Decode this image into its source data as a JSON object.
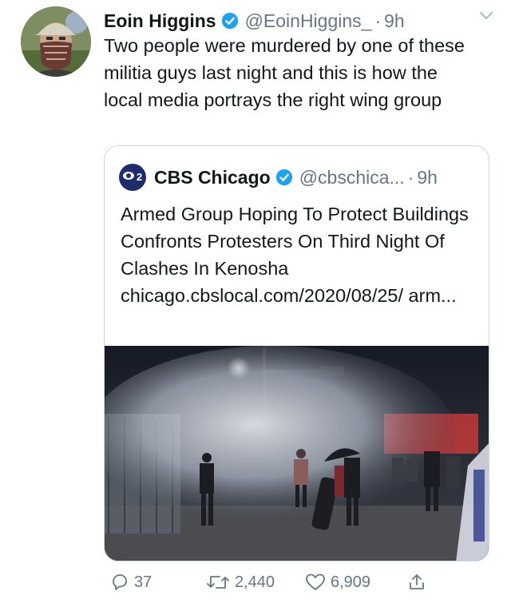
{
  "tweet": {
    "author": {
      "name": "Eoin Higgins",
      "handle": "@EoinHiggins_",
      "separator": "·",
      "time": "9h"
    },
    "text": "Two people were murdered by one of these militia guys last night and this is how the local media portrays the right wing group",
    "quote": {
      "name": "CBS Chicago",
      "handle": "@cbschica...",
      "separator": "·",
      "time": "9h",
      "logo_text": "2",
      "text": "Armed Group Hoping To Protect Buildings Confronts Protesters On Third Night Of Clashes In Kenosha chicago.cbslocal.com/2020/08/25/ arm..."
    },
    "actions": {
      "replies": "37",
      "retweets": "2,440",
      "likes": "6,909"
    }
  },
  "colors": {
    "verified": "#1da1f2",
    "secondary_text": "#657786",
    "border": "#ccd6dd",
    "cbs_badge": "#1f2c6b"
  },
  "icons": [
    "verified-badge-icon",
    "caret-down-icon",
    "reply-icon",
    "retweet-icon",
    "like-icon",
    "share-icon"
  ]
}
